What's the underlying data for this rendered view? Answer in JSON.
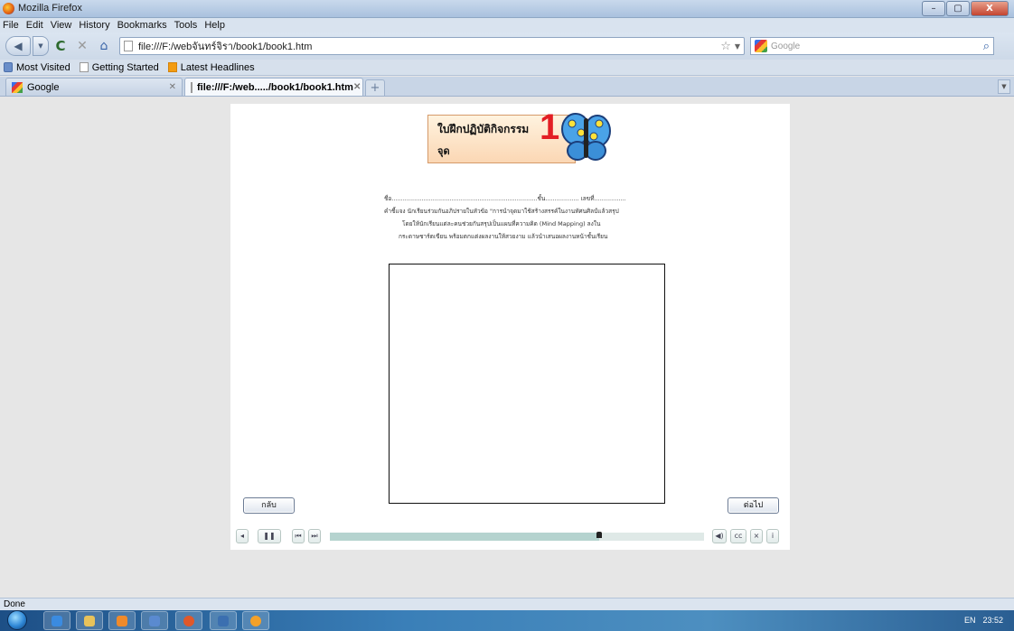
{
  "window": {
    "title": "Mozilla Firefox",
    "minimize": "–",
    "maximize": "▢",
    "close": "X"
  },
  "menu": [
    "File",
    "Edit",
    "View",
    "History",
    "Bookmarks",
    "Tools",
    "Help"
  ],
  "nav": {
    "url": "file:///F:/webจันทร์จิรา/book1/book1.htm",
    "search_placeholder": "Google"
  },
  "bookmarks": [
    "Most Visited",
    "Getting Started",
    "Latest Headlines"
  ],
  "tabs": [
    {
      "label": "Google"
    },
    {
      "label": "file:///F:/web...../book1/book1.htm"
    }
  ],
  "page": {
    "banner_title": "ใบฝึกปฏิบัติกิจกรรม",
    "banner_sub": "จุด",
    "banner_number": "1",
    "name_line": "ชื่อ..............................................................................ชั้น.................. เลขที่.................",
    "instruction_1": "คำชี้แจง  นักเรียนร่วมกันอภิปรายในหัวข้อ \"การนำจุดมาใช้สร้างสรรค์ในงานทัศนศิลป์แล้วสรุป",
    "instruction_2": "โดยให้นักเรียนแต่ละคนช่วยกันสรุปเป็นแผนที่ความคิด (Mind Mapping) ลงใน",
    "instruction_3": "กระดาษชาร์ตเขียน  พร้อมตกแต่งผลงานให้สวยงาม แล้วนำเสนอผลงานหน้าชั้นเรียน",
    "back_label": "กลับ",
    "next_label": "ต่อไป",
    "progress": 0.72
  },
  "player": {
    "prev": "◂",
    "pause": "❚❚",
    "first": "⏮",
    "last": "⏭",
    "volume": "◀)",
    "cc": "cc",
    "close": "×",
    "info": "i"
  },
  "status": {
    "text": "Done"
  },
  "tray": {
    "lang": "EN",
    "time": "23:52"
  }
}
